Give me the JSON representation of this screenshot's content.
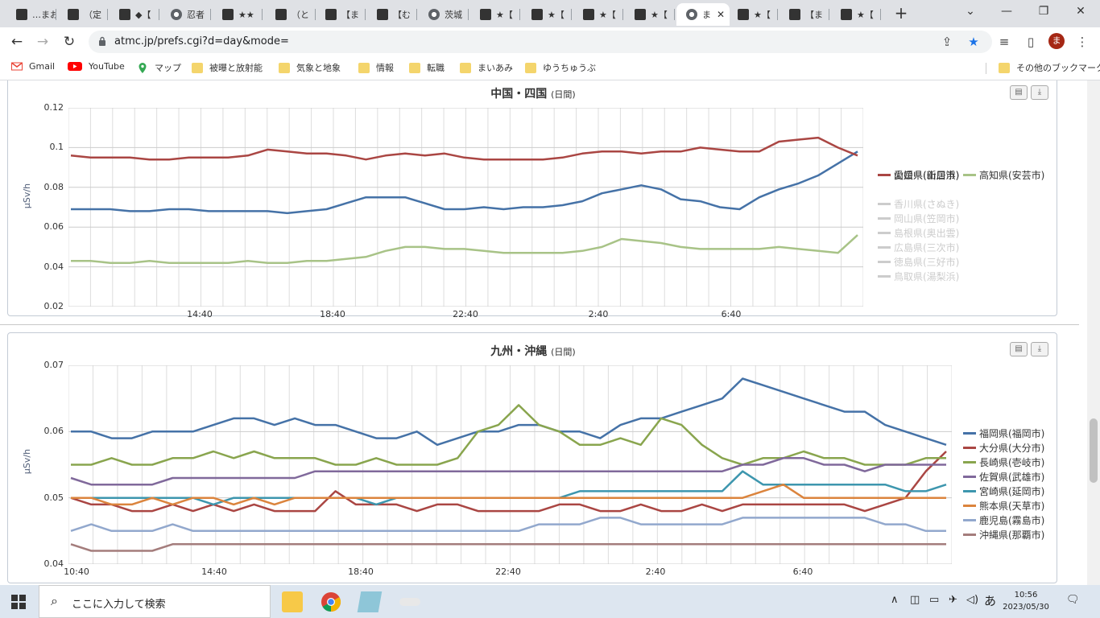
{
  "browser": {
    "tabs": [
      {
        "label": "…まおこ"
      },
      {
        "label": "（定"
      },
      {
        "label": "◆【"
      },
      {
        "label": "忍者"
      },
      {
        "label": "★★"
      },
      {
        "label": "（と"
      },
      {
        "label": "【ま"
      },
      {
        "label": "【む"
      },
      {
        "label": "茨城"
      },
      {
        "label": "★【"
      },
      {
        "label": "★【"
      },
      {
        "label": "★【"
      },
      {
        "label": "★【"
      },
      {
        "label": "ま"
      },
      {
        "label": "★【"
      },
      {
        "label": "【ま"
      },
      {
        "label": "★【"
      }
    ],
    "url": "atmc.jp/prefs.cgi?d=day&mode=",
    "profile_initial": "ま",
    "bookmarks": [
      {
        "label": "Gmail"
      },
      {
        "label": "YouTube"
      },
      {
        "label": "マップ"
      },
      {
        "label": "被曝と放射能"
      },
      {
        "label": "気象と地象"
      },
      {
        "label": "情報"
      },
      {
        "label": "転職"
      },
      {
        "label": "まいあみ"
      },
      {
        "label": "ゆうちゅうぶ"
      }
    ],
    "other_bookmarks": "その他のブックマーク"
  },
  "chart_data": [
    {
      "type": "line",
      "title": "中国・四国",
      "subtitle": "(日間)",
      "ylabel": "µSv/h",
      "ylim": [
        0.02,
        0.12
      ],
      "yticks": [
        "0.12",
        "0.1",
        "0.08",
        "0.06",
        "0.04",
        "0.02"
      ],
      "xticks": [
        "14:40",
        "18:40",
        "22:40",
        "2:40",
        "6:40"
      ],
      "legend_position": "right",
      "series": [
        {
          "name": "愛媛県(新居浜)",
          "color": "#4572a7",
          "visible": true,
          "values": [
            0.069,
            0.069,
            0.069,
            0.068,
            0.068,
            0.069,
            0.069,
            0.068,
            0.068,
            0.068,
            0.068,
            0.067,
            0.068,
            0.069,
            0.072,
            0.075,
            0.075,
            0.075,
            0.072,
            0.069,
            0.069,
            0.07,
            0.069,
            0.07,
            0.07,
            0.071,
            0.073,
            0.077,
            0.079,
            0.081,
            0.079,
            0.074,
            0.073,
            0.07,
            0.069,
            0.075,
            0.079,
            0.082,
            0.086,
            0.092,
            0.098
          ]
        },
        {
          "name": "山口県(山口市)",
          "color": "#aa4643",
          "visible": true,
          "values": [
            0.096,
            0.095,
            0.095,
            0.095,
            0.094,
            0.094,
            0.095,
            0.095,
            0.095,
            0.096,
            0.099,
            0.098,
            0.097,
            0.097,
            0.096,
            0.094,
            0.096,
            0.097,
            0.096,
            0.097,
            0.095,
            0.094,
            0.094,
            0.094,
            0.094,
            0.095,
            0.097,
            0.098,
            0.098,
            0.097,
            0.098,
            0.098,
            0.1,
            0.099,
            0.098,
            0.098,
            0.103,
            0.104,
            0.105,
            0.1,
            0.096
          ]
        },
        {
          "name": "高知県(安芸市)",
          "color": "#a8c387",
          "visible": true,
          "values": [
            0.043,
            0.043,
            0.042,
            0.042,
            0.043,
            0.042,
            0.042,
            0.042,
            0.042,
            0.043,
            0.042,
            0.042,
            0.043,
            0.043,
            0.044,
            0.045,
            0.048,
            0.05,
            0.05,
            0.049,
            0.049,
            0.048,
            0.047,
            0.047,
            0.047,
            0.047,
            0.048,
            0.05,
            0.054,
            0.053,
            0.052,
            0.05,
            0.049,
            0.049,
            0.049,
            0.049,
            0.05,
            0.049,
            0.048,
            0.047,
            0.056
          ]
        },
        {
          "name": "香川県(さぬき)",
          "color": "#cccccc",
          "visible": false,
          "values": []
        },
        {
          "name": "岡山県(笠岡市)",
          "color": "#cccccc",
          "visible": false,
          "values": []
        },
        {
          "name": "島根県(奥出雲)",
          "color": "#cccccc",
          "visible": false,
          "values": []
        },
        {
          "name": "広島県(三次市)",
          "color": "#cccccc",
          "visible": false,
          "values": []
        },
        {
          "name": "徳島県(三好市)",
          "color": "#cccccc",
          "visible": false,
          "values": []
        },
        {
          "name": "鳥取県(湯梨浜)",
          "color": "#cccccc",
          "visible": false,
          "values": []
        }
      ]
    },
    {
      "type": "line",
      "title": "九州・沖縄",
      "subtitle": "(日間)",
      "ylabel": "µSv/h",
      "ylim": [
        0.04,
        0.07
      ],
      "yticks": [
        "0.07",
        "0.06",
        "0.05",
        "0.04"
      ],
      "xticks": [
        "10:40",
        "14:40",
        "18:40",
        "22:40",
        "2:40",
        "6:40"
      ],
      "legend_position": "right",
      "series": [
        {
          "name": "福岡県(福岡市)",
          "color": "#4572a7",
          "visible": true,
          "values": [
            0.06,
            0.06,
            0.059,
            0.059,
            0.06,
            0.06,
            0.06,
            0.061,
            0.062,
            0.062,
            0.061,
            0.062,
            0.061,
            0.061,
            0.06,
            0.059,
            0.059,
            0.06,
            0.058,
            0.059,
            0.06,
            0.06,
            0.061,
            0.061,
            0.06,
            0.06,
            0.059,
            0.061,
            0.062,
            0.062,
            0.063,
            0.064,
            0.065,
            0.068,
            0.067,
            0.066,
            0.065,
            0.064,
            0.063,
            0.063,
            0.061,
            0.06,
            0.059,
            0.058
          ]
        },
        {
          "name": "大分県(大分市)",
          "color": "#aa4643",
          "visible": true,
          "values": [
            0.05,
            0.049,
            0.049,
            0.048,
            0.048,
            0.049,
            0.048,
            0.049,
            0.048,
            0.049,
            0.048,
            0.048,
            0.048,
            0.051,
            0.049,
            0.049,
            0.049,
            0.048,
            0.049,
            0.049,
            0.048,
            0.048,
            0.048,
            0.048,
            0.049,
            0.049,
            0.048,
            0.048,
            0.049,
            0.048,
            0.048,
            0.049,
            0.048,
            0.049,
            0.049,
            0.049,
            0.049,
            0.049,
            0.049,
            0.048,
            0.049,
            0.05,
            0.054,
            0.057
          ]
        },
        {
          "name": "長崎県(壱岐市)",
          "color": "#89a54e",
          "visible": true,
          "values": [
            0.055,
            0.055,
            0.056,
            0.055,
            0.055,
            0.056,
            0.056,
            0.057,
            0.056,
            0.057,
            0.056,
            0.056,
            0.056,
            0.055,
            0.055,
            0.056,
            0.055,
            0.055,
            0.055,
            0.056,
            0.06,
            0.061,
            0.064,
            0.061,
            0.06,
            0.058,
            0.058,
            0.059,
            0.058,
            0.062,
            0.061,
            0.058,
            0.056,
            0.055,
            0.056,
            0.056,
            0.057,
            0.056,
            0.056,
            0.055,
            0.055,
            0.055,
            0.056,
            0.056
          ]
        },
        {
          "name": "佐賀県(武雄市)",
          "color": "#80699b",
          "visible": true,
          "values": [
            0.053,
            0.052,
            0.052,
            0.052,
            0.052,
            0.053,
            0.053,
            0.053,
            0.053,
            0.053,
            0.053,
            0.053,
            0.054,
            0.054,
            0.054,
            0.054,
            0.054,
            0.054,
            0.054,
            0.054,
            0.054,
            0.054,
            0.054,
            0.054,
            0.054,
            0.054,
            0.054,
            0.054,
            0.054,
            0.054,
            0.054,
            0.054,
            0.054,
            0.055,
            0.055,
            0.056,
            0.056,
            0.055,
            0.055,
            0.054,
            0.055,
            0.055,
            0.055,
            0.055
          ]
        },
        {
          "name": "宮崎県(延岡市)",
          "color": "#3d96ae",
          "visible": true,
          "values": [
            0.05,
            0.05,
            0.05,
            0.05,
            0.05,
            0.05,
            0.05,
            0.049,
            0.05,
            0.05,
            0.05,
            0.05,
            0.05,
            0.05,
            0.05,
            0.049,
            0.05,
            0.05,
            0.05,
            0.05,
            0.05,
            0.05,
            0.05,
            0.05,
            0.05,
            0.051,
            0.051,
            0.051,
            0.051,
            0.051,
            0.051,
            0.051,
            0.051,
            0.054,
            0.052,
            0.052,
            0.052,
            0.052,
            0.052,
            0.052,
            0.052,
            0.051,
            0.051,
            0.052
          ]
        },
        {
          "name": "熊本県(天草市)",
          "color": "#db843d",
          "visible": true,
          "values": [
            0.05,
            0.05,
            0.049,
            0.049,
            0.05,
            0.049,
            0.05,
            0.05,
            0.049,
            0.05,
            0.049,
            0.05,
            0.05,
            0.05,
            0.05,
            0.05,
            0.05,
            0.05,
            0.05,
            0.05,
            0.05,
            0.05,
            0.05,
            0.05,
            0.05,
            0.05,
            0.05,
            0.05,
            0.05,
            0.05,
            0.05,
            0.05,
            0.05,
            0.05,
            0.051,
            0.052,
            0.05,
            0.05,
            0.05,
            0.05,
            0.05,
            0.05,
            0.05,
            0.05
          ]
        },
        {
          "name": "鹿児島(霧島市)",
          "color": "#92a8cd",
          "visible": true,
          "values": [
            0.045,
            0.046,
            0.045,
            0.045,
            0.045,
            0.046,
            0.045,
            0.045,
            0.045,
            0.045,
            0.045,
            0.045,
            0.045,
            0.045,
            0.045,
            0.045,
            0.045,
            0.045,
            0.045,
            0.045,
            0.045,
            0.045,
            0.045,
            0.046,
            0.046,
            0.046,
            0.047,
            0.047,
            0.046,
            0.046,
            0.046,
            0.046,
            0.046,
            0.047,
            0.047,
            0.047,
            0.047,
            0.047,
            0.047,
            0.047,
            0.046,
            0.046,
            0.045,
            0.045
          ]
        },
        {
          "name": "沖縄県(那覇市)",
          "color": "#a47d7c",
          "visible": true,
          "values": [
            0.043,
            0.042,
            0.042,
            0.042,
            0.042,
            0.043,
            0.043,
            0.043,
            0.043,
            0.043,
            0.043,
            0.043,
            0.043,
            0.043,
            0.043,
            0.043,
            0.043,
            0.043,
            0.043,
            0.043,
            0.043,
            0.043,
            0.043,
            0.043,
            0.043,
            0.043,
            0.043,
            0.043,
            0.043,
            0.043,
            0.043,
            0.043,
            0.043,
            0.043,
            0.043,
            0.043,
            0.043,
            0.043,
            0.043,
            0.043,
            0.043,
            0.043,
            0.043,
            0.043
          ]
        }
      ]
    }
  ],
  "taskbar": {
    "search_placeholder": "ここに入力して検索",
    "time": "10:56",
    "date": "2023/05/30",
    "ime": "あ"
  }
}
